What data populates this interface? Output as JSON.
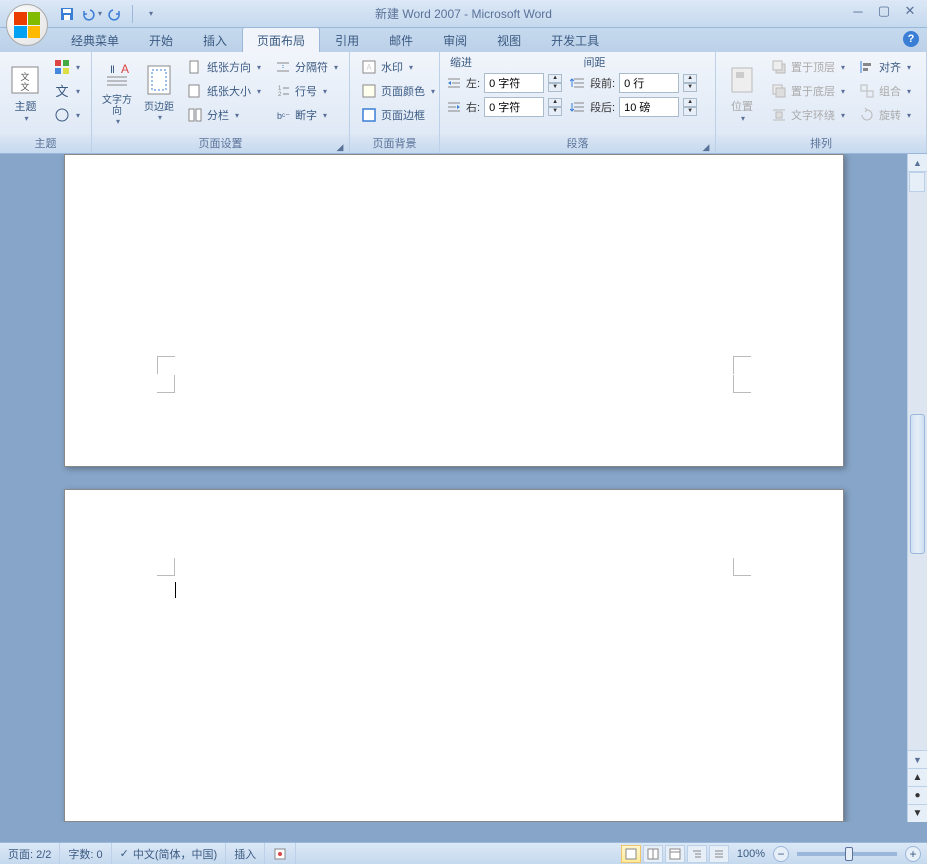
{
  "title": "新建 Word 2007 - Microsoft Word",
  "qat": {
    "save": "保存",
    "undo": "撤销",
    "redo": "重做"
  },
  "tabs": [
    "经典菜单",
    "开始",
    "插入",
    "页面布局",
    "引用",
    "邮件",
    "审阅",
    "视图",
    "开发工具"
  ],
  "active_tab_index": 3,
  "ribbon": {
    "group_theme": {
      "label": "主题",
      "theme_btn": "主题",
      "colors": "颜色",
      "fonts": "文字",
      "effects": "效果"
    },
    "group_pagesetup": {
      "label": "页面设置",
      "text_dir": "文字方向",
      "margins": "页边距",
      "orientation": "纸张方向",
      "size": "纸张大小",
      "columns": "分栏",
      "breaks": "分隔符",
      "line_numbers": "行号",
      "hyphenation": "断字"
    },
    "group_pagebg": {
      "label": "页面背景",
      "watermark": "水印",
      "page_color": "页面颜色",
      "page_borders": "页面边框"
    },
    "group_paragraph": {
      "label": "段落",
      "indent_header": "缩进",
      "spacing_header": "间距",
      "indent_left_label": "左:",
      "indent_left_value": "0 字符",
      "indent_right_label": "右:",
      "indent_right_value": "0 字符",
      "before_label": "段前:",
      "before_value": "0 行",
      "after_label": "段后:",
      "after_value": "10 磅"
    },
    "group_arrange": {
      "label": "排列",
      "position": "位置",
      "bring_front": "置于顶层",
      "send_back": "置于底层",
      "text_wrap": "文字环绕",
      "align": "对齐",
      "group": "组合",
      "rotate": "旋转"
    }
  },
  "status": {
    "page": "页面: 2/2",
    "words": "字数: 0",
    "language": "中文(简体，中国)",
    "mode": "插入",
    "zoom": "100%"
  }
}
